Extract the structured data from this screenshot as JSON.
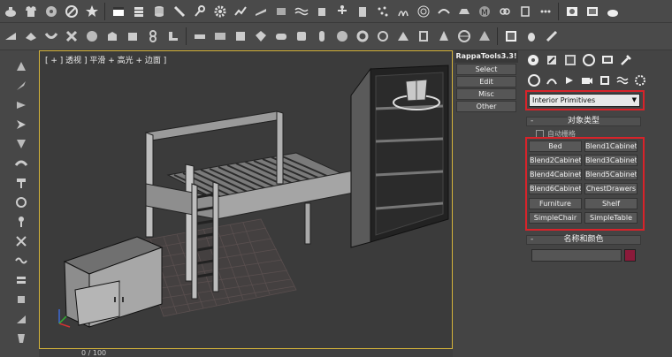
{
  "viewport": {
    "label": "[ + ] 透视 ] 平滑 + 高光 + 边面 ]",
    "frame_counter": "0 / 100"
  },
  "rappa": {
    "title": "RappaTools3.3!",
    "buttons": [
      "Select",
      "Edit",
      "Misc",
      "Other"
    ]
  },
  "command_panel": {
    "category_dropdown": "Interior Primitives",
    "object_type_title": "对象类型",
    "auto_grid_label": "自动栅格",
    "object_buttons": [
      "Bed",
      "Blend1Cabinet",
      "Blend2Cabinet",
      "Blend3Cabinet",
      "Blend4Cabinet",
      "Blend5Cabinet",
      "Blend6Cabinet",
      "ChestDrawers",
      "Furniture",
      "Shelf",
      "SimpleChair",
      "SimpleTable"
    ],
    "name_color_title": "名称和颜色",
    "object_color": "#8b1a3a"
  },
  "colors": {
    "highlight_box": "#d8232a",
    "viewport_border": "#d5b43a"
  }
}
